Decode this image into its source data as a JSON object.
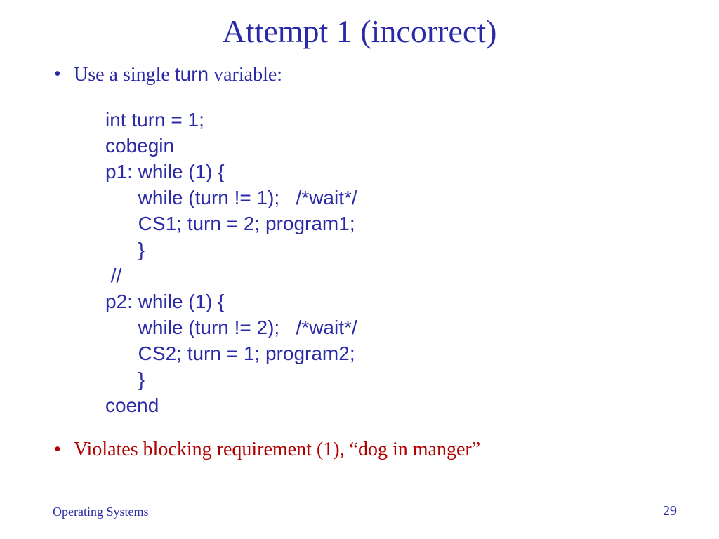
{
  "title": "Attempt 1 (incorrect)",
  "bullet": {
    "prefix": "Use a single ",
    "turnword": "turn",
    "suffix": " variable:"
  },
  "code": "int turn = 1;\ncobegin\np1: while (1) {\n      while (turn != 1);   /*wait*/\n      CS1; turn = 2; program1;\n      }\n //\np2: while (1) {\n      while (turn != 2);   /*wait*/\n      CS2; turn = 1; program2;\n      }\ncoend",
  "violates": "Violates blocking requirement (1), “dog in manger”",
  "footer": {
    "left": "Operating Systems",
    "right": "29"
  }
}
